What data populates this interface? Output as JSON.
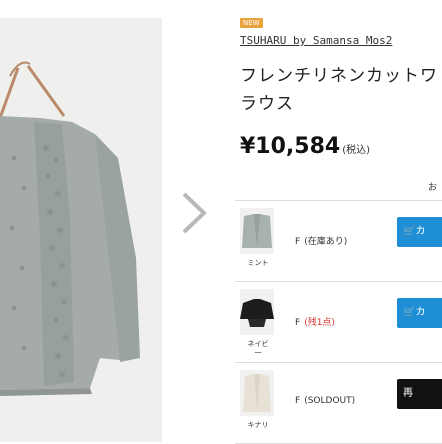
{
  "product": {
    "badge": "NEW",
    "brand": "TSUHARU by Samansa Mos2",
    "title_lines": [
      "フレンチリネンカットワ",
      "ラウス"
    ],
    "price": "¥10,584",
    "tax_note": "(税込)",
    "cut_label": "お"
  },
  "variants": [
    {
      "color": "ミント",
      "size": "F",
      "stock": "(在庫あり)",
      "stock_color": "#333333",
      "button": "カ",
      "button_color": "#1e8fd6",
      "swatch": "#a7b1ad"
    },
    {
      "color": "ネイビ\n一",
      "size": "F",
      "stock": "(残1点)",
      "stock_color": "#d0342c",
      "button": "カ",
      "button_color": "#1e8fd6",
      "swatch": "#1c1c1e"
    },
    {
      "color": "キナリ",
      "size": "F",
      "stock": "(SOLDOUT)",
      "stock_color": "#333333",
      "button": "再",
      "button_color": "#111111",
      "swatch": "#e8e2d6"
    }
  ],
  "icons": {
    "next": "chevron-right-icon",
    "cart": "cart-icon",
    "hanger": "hanger-icon"
  },
  "colors": {
    "accent_blue": "#1e8fd6",
    "badge_orange": "#e8a33d",
    "warn_red": "#d0342c"
  }
}
